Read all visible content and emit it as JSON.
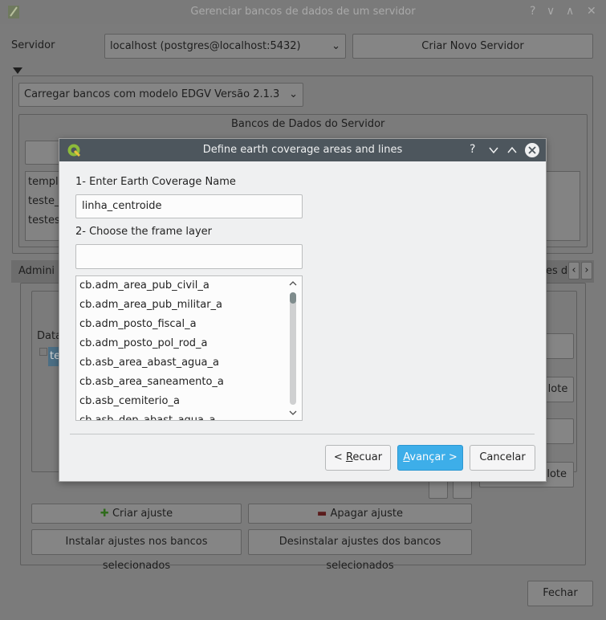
{
  "background": {
    "window_title": "Gerenciar bancos de dados de um servidor",
    "title_controls": [
      "?",
      "∨",
      "∧",
      "✕"
    ],
    "server_label": "Servidor",
    "server_select": "localhost (postgres@localhost:5432)",
    "create_server_button": "Criar Novo Servidor",
    "load_db_select": "Carregar bancos com modelo EDGV Versão 2.1.3",
    "server_dbs_title": "Bancos de Dados do Servidor",
    "db_list": [
      "templa",
      "teste_t",
      "testes_"
    ],
    "admin_tab": "Admini",
    "right_tab": "es de",
    "data_header": "Data",
    "selected_cell": "te",
    "lote_button_1": "lote",
    "lote_button_2": "lote",
    "create_adjust_button": "Criar ajuste",
    "delete_adjust_button": "Apagar ajuste",
    "install_button": "Instalar ajustes nos bancos selecionados",
    "uninstall_button": "Desinstalar ajustes dos bancos selecionados",
    "close_button": "Fechar"
  },
  "dialog": {
    "title": "Define earth coverage areas and lines",
    "help": "?",
    "step1_label": "1- Enter Earth Coverage Name",
    "coverage_name": "linha_centroide",
    "step2_label": "2- Choose the frame layer",
    "frame_filter": "",
    "layers": [
      "cb.adm_area_pub_civil_a",
      "cb.adm_area_pub_militar_a",
      "cb.adm_posto_fiscal_a",
      "cb.adm_posto_pol_rod_a",
      "cb.asb_area_abast_agua_a",
      "cb.asb_area_saneamento_a",
      "cb.asb_cemiterio_a",
      "cb.asb_dep_abast_agua_a"
    ],
    "back_button": {
      "prefix": "< ",
      "mnemonic": "R",
      "rest": "ecuar"
    },
    "next_button": {
      "mnemonic": "A",
      "rest": "vançar >"
    },
    "cancel_button": "Cancelar"
  },
  "colors": {
    "accent": "#3daee9",
    "titlebar": "#4d565d"
  }
}
